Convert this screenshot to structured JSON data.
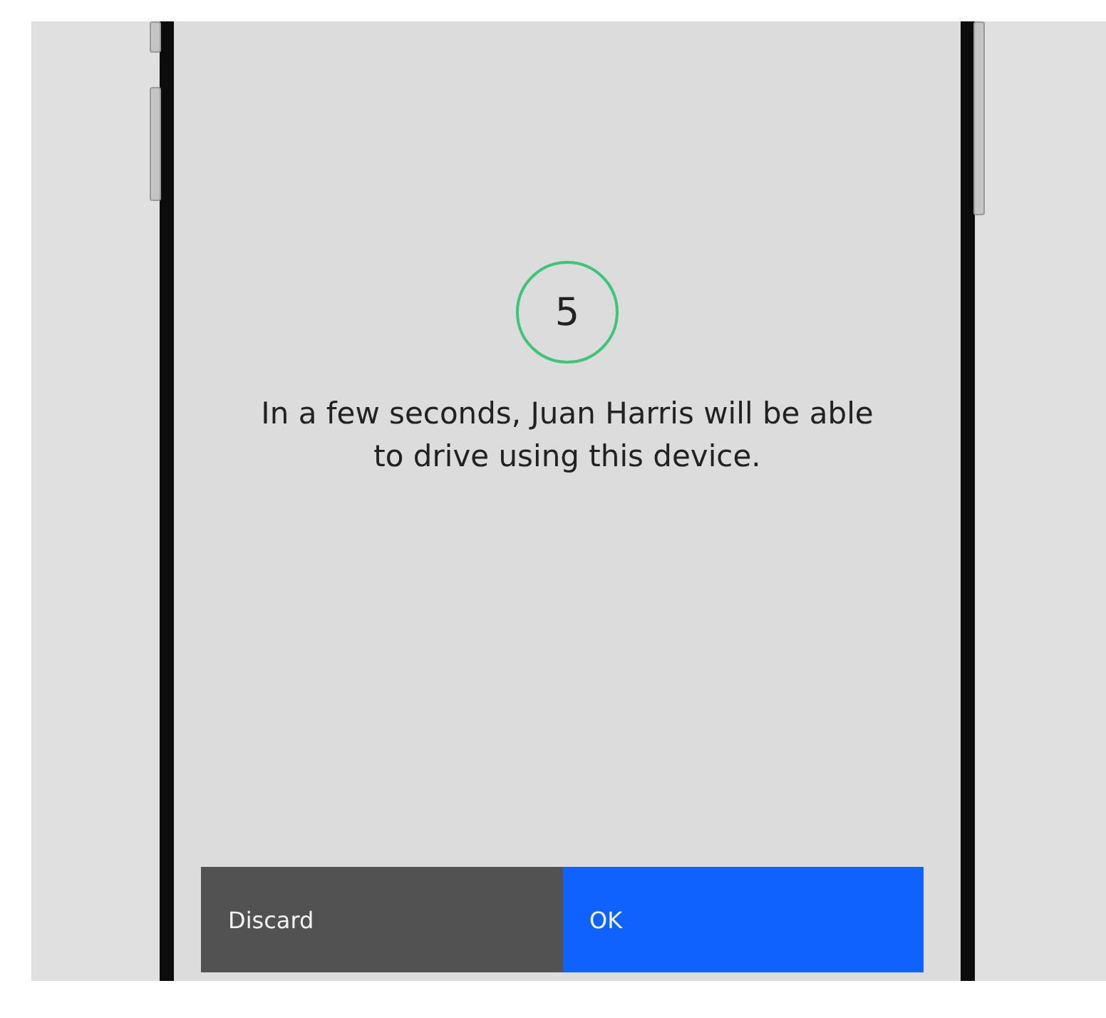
{
  "countdown": {
    "value": "5"
  },
  "message": "In a few seconds, Juan Harris will be able to drive using this device.",
  "buttons": [
    {
      "label": "Discard",
      "kind": "secondary"
    },
    {
      "label": "OK",
      "kind": "primary"
    }
  ]
}
